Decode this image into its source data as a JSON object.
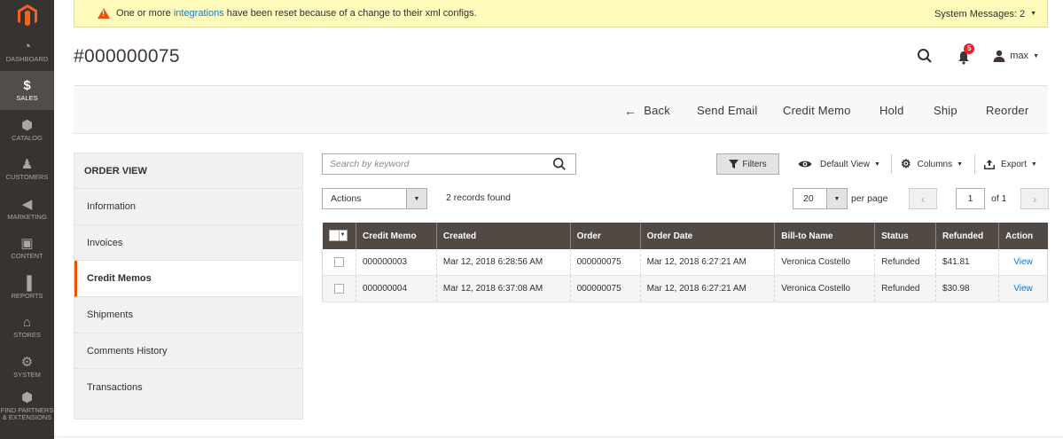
{
  "sidebar": {
    "items": [
      {
        "label": "DASHBOARD",
        "icon": "gauge-icon",
        "glyph": "◔"
      },
      {
        "label": "SALES",
        "icon": "dollar-icon",
        "glyph": "$"
      },
      {
        "label": "CATALOG",
        "icon": "cube-icon",
        "glyph": "⬢"
      },
      {
        "label": "CUSTOMERS",
        "icon": "person-icon",
        "glyph": "♟"
      },
      {
        "label": "MARKETING",
        "icon": "megaphone-icon",
        "glyph": "◀"
      },
      {
        "label": "CONTENT",
        "icon": "layout-icon",
        "glyph": "▣"
      },
      {
        "label": "REPORTS",
        "icon": "bar-chart-icon",
        "glyph": "▐"
      },
      {
        "label": "STORES",
        "icon": "storefront-icon",
        "glyph": "⌂"
      },
      {
        "label": "SYSTEM",
        "icon": "gear-icon",
        "glyph": "⚙"
      },
      {
        "label": "FIND PARTNERS & EXTENSIONS",
        "icon": "box-icon",
        "glyph": "⬢"
      }
    ],
    "active": "SALES",
    "accent": "#eb5202"
  },
  "system_message": {
    "text_before": "One or more",
    "link": "integrations",
    "text_after": "have been reset because of a change to their xml configs.",
    "counter": "System Messages: 2"
  },
  "header": {
    "title": "#000000075",
    "notifications_count": "5",
    "user": "max"
  },
  "toolbar": {
    "back": "Back",
    "send_email": "Send Email",
    "credit_memo": "Credit Memo",
    "hold": "Hold",
    "ship": "Ship",
    "reorder": "Reorder"
  },
  "order_view": {
    "title": "ORDER VIEW",
    "tabs": [
      "Information",
      "Invoices",
      "Credit Memos",
      "Shipments",
      "Comments History",
      "Transactions"
    ],
    "active_tab": "Credit Memos"
  },
  "grid_controls": {
    "search_placeholder": "Search by keyword",
    "filters": "Filters",
    "default_view": "Default View",
    "columns": "Columns",
    "export": "Export",
    "actions": "Actions",
    "records_found": "2 records found",
    "per_page_value": "20",
    "per_page_label": "per page",
    "page_value": "1",
    "page_of": "of 1"
  },
  "grid": {
    "headers": [
      "Credit Memo",
      "Created",
      "Order",
      "Order Date",
      "Bill-to Name",
      "Status",
      "Refunded",
      "Action"
    ],
    "rows": [
      {
        "credit_memo": "000000003",
        "created": "Mar 12, 2018 6:28:56 AM",
        "order": "000000075",
        "order_date": "Mar 12, 2018 6:27:21 AM",
        "bill_to": "Veronica Costello",
        "status": "Refunded",
        "refunded": "$41.81",
        "action": "View"
      },
      {
        "credit_memo": "000000004",
        "created": "Mar 12, 2018 6:37:08 AM",
        "order": "000000075",
        "order_date": "Mar 12, 2018 6:27:21 AM",
        "bill_to": "Veronica Costello",
        "status": "Refunded",
        "refunded": "$30.98",
        "action": "View"
      }
    ]
  }
}
